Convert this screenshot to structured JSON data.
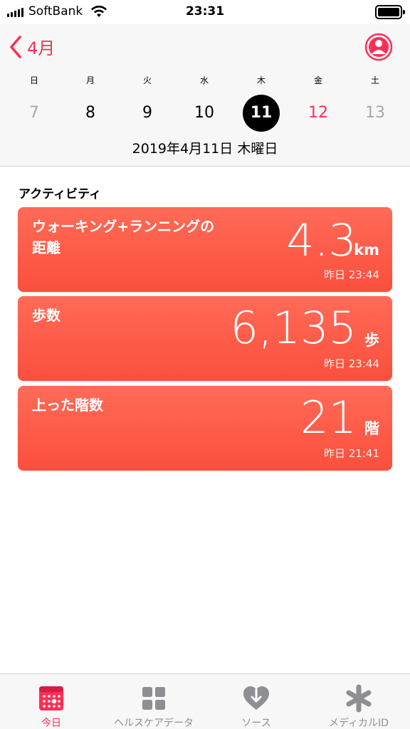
{
  "status_bar": {
    "carrier": "SoftBank",
    "time": "23:31"
  },
  "header": {
    "back_label": "4月",
    "weekdays": [
      "日",
      "月",
      "火",
      "水",
      "木",
      "金",
      "土"
    ],
    "dates": [
      "7",
      "8",
      "9",
      "10",
      "11",
      "12",
      "13"
    ],
    "selected_index": 4,
    "selected_date": "2019年4月11日 木曜日"
  },
  "colors": {
    "accent": "#ff2d55",
    "weekend": "#a8a8a8",
    "holiday": "#ff2d55",
    "card": "#fb5944"
  },
  "activity": {
    "title": "アクティビティ",
    "cards": [
      {
        "title_line1": "ウォーキング+ランニングの",
        "title_line2": "距離",
        "value": "4.3",
        "unit": "km",
        "time": "昨日 23:44"
      },
      {
        "title_line1": "歩数",
        "title_line2": "",
        "value": "6,135",
        "unit": "歩",
        "time": "昨日 23:44"
      },
      {
        "title_line1": "上った階数",
        "title_line2": "",
        "value": "21",
        "unit": "階",
        "time": "昨日 21:41"
      }
    ]
  },
  "tabs": [
    {
      "label": "今日",
      "icon": "calendar-icon",
      "active": true
    },
    {
      "label": "ヘルスケアデータ",
      "icon": "grid-icon",
      "active": false
    },
    {
      "label": "ソース",
      "icon": "heart-arrow-icon",
      "active": false
    },
    {
      "label": "メディカルID",
      "icon": "asterisk-icon",
      "active": false
    }
  ]
}
